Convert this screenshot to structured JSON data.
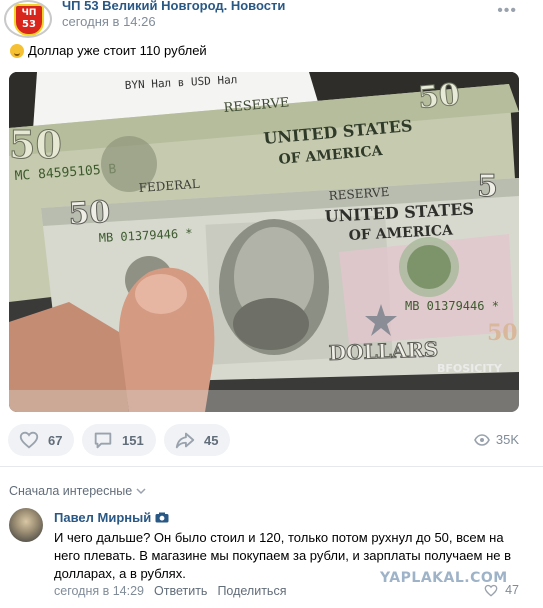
{
  "post": {
    "group_name": "ЧП 53 Великий Новгород. Новости",
    "avatar_text_top": "ЧП",
    "avatar_text_bottom": "53",
    "time": "сегодня в 14:26",
    "text": "Доллар уже стоит 110 рублей",
    "image": {
      "receipt_text": "BYN Нал в USD Нал",
      "bill_back_serial": "MC 84595105 B",
      "bill_front_serial": "MB 01379446 *",
      "bill_front_serial_right": "MB 01379446 *",
      "denomination": "50",
      "watermark": "BFOSICITY"
    }
  },
  "actions": {
    "likes": "67",
    "comments": "151",
    "shares": "45",
    "views": "35K"
  },
  "comments": {
    "sort_label": "Сначала интересные",
    "items": [
      {
        "author": "Павел Мирный",
        "text": "И чего дальше? Он было стоил и 120, только потом рухнул до 50, всем на него плевать. В магазине мы покупаем за рубли, и зарплаты получаем не в долларах, а в рублях.",
        "time": "сегодня в 14:29",
        "reply_label": "Ответить",
        "share_label": "Поделиться",
        "likes": "47"
      }
    ]
  },
  "site_watermark": "YAPLAKAL.COM"
}
